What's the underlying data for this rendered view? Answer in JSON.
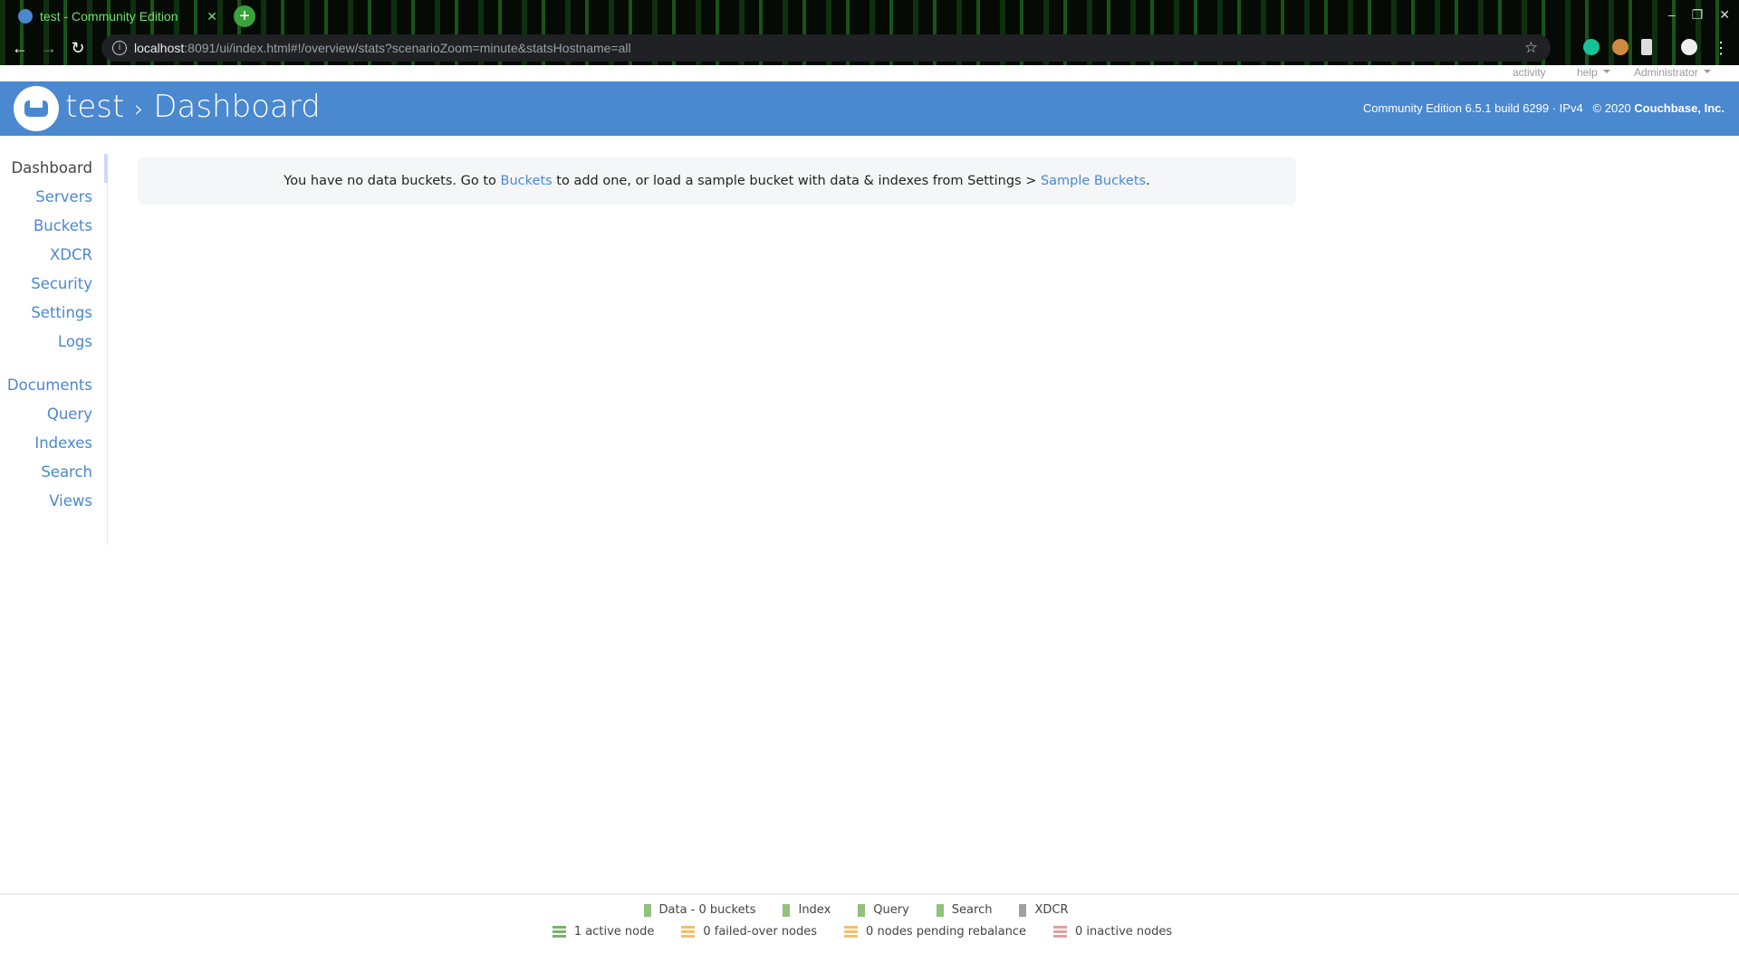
{
  "browser": {
    "tab_title": "test - Community Edition",
    "url_host": "localhost",
    "url_rest": ":8091/ui/index.html#!/overview/stats?scenarioZoom=minute&statsHostname=all"
  },
  "topnav": {
    "activity": "activity",
    "help": "help",
    "user": "Administrator"
  },
  "header": {
    "cluster": "test",
    "separator": "›",
    "page": "Dashboard",
    "version": "Community Edition 6.5.1 build 6299 · IPv4",
    "copyright": "© 2020",
    "company": "Couchbase, Inc.",
    "color": "#4a88d0"
  },
  "sidebar": {
    "items": [
      {
        "label": "Dashboard"
      },
      {
        "label": "Servers"
      },
      {
        "label": "Buckets"
      },
      {
        "label": "XDCR"
      },
      {
        "label": "Security"
      },
      {
        "label": "Settings"
      },
      {
        "label": "Logs"
      },
      {
        "label": "Documents"
      },
      {
        "label": "Query"
      },
      {
        "label": "Indexes"
      },
      {
        "label": "Search"
      },
      {
        "label": "Views"
      }
    ]
  },
  "message": {
    "part1": "You have no data buckets. Go to ",
    "link1": "Buckets",
    "part2": " to add one, or load a sample bucket with data & indexes from Settings > ",
    "link2": "Sample Buckets",
    "part3": "."
  },
  "footer": {
    "services": [
      {
        "label": "Data - 0 buckets",
        "color": "#8fc27a"
      },
      {
        "label": "Index",
        "color": "#8fc27a"
      },
      {
        "label": "Query",
        "color": "#8fc27a"
      },
      {
        "label": "Search",
        "color": "#8fc27a"
      },
      {
        "label": "XDCR",
        "color": "#a0a0a0"
      }
    ],
    "nodes": [
      {
        "label": "1 active node",
        "color": "#7ab36a"
      },
      {
        "label": "0 failed-over nodes",
        "color": "#f0c070"
      },
      {
        "label": "0 nodes pending rebalance",
        "color": "#f0c070"
      },
      {
        "label": "0 inactive nodes",
        "color": "#e0a0a0"
      }
    ]
  }
}
